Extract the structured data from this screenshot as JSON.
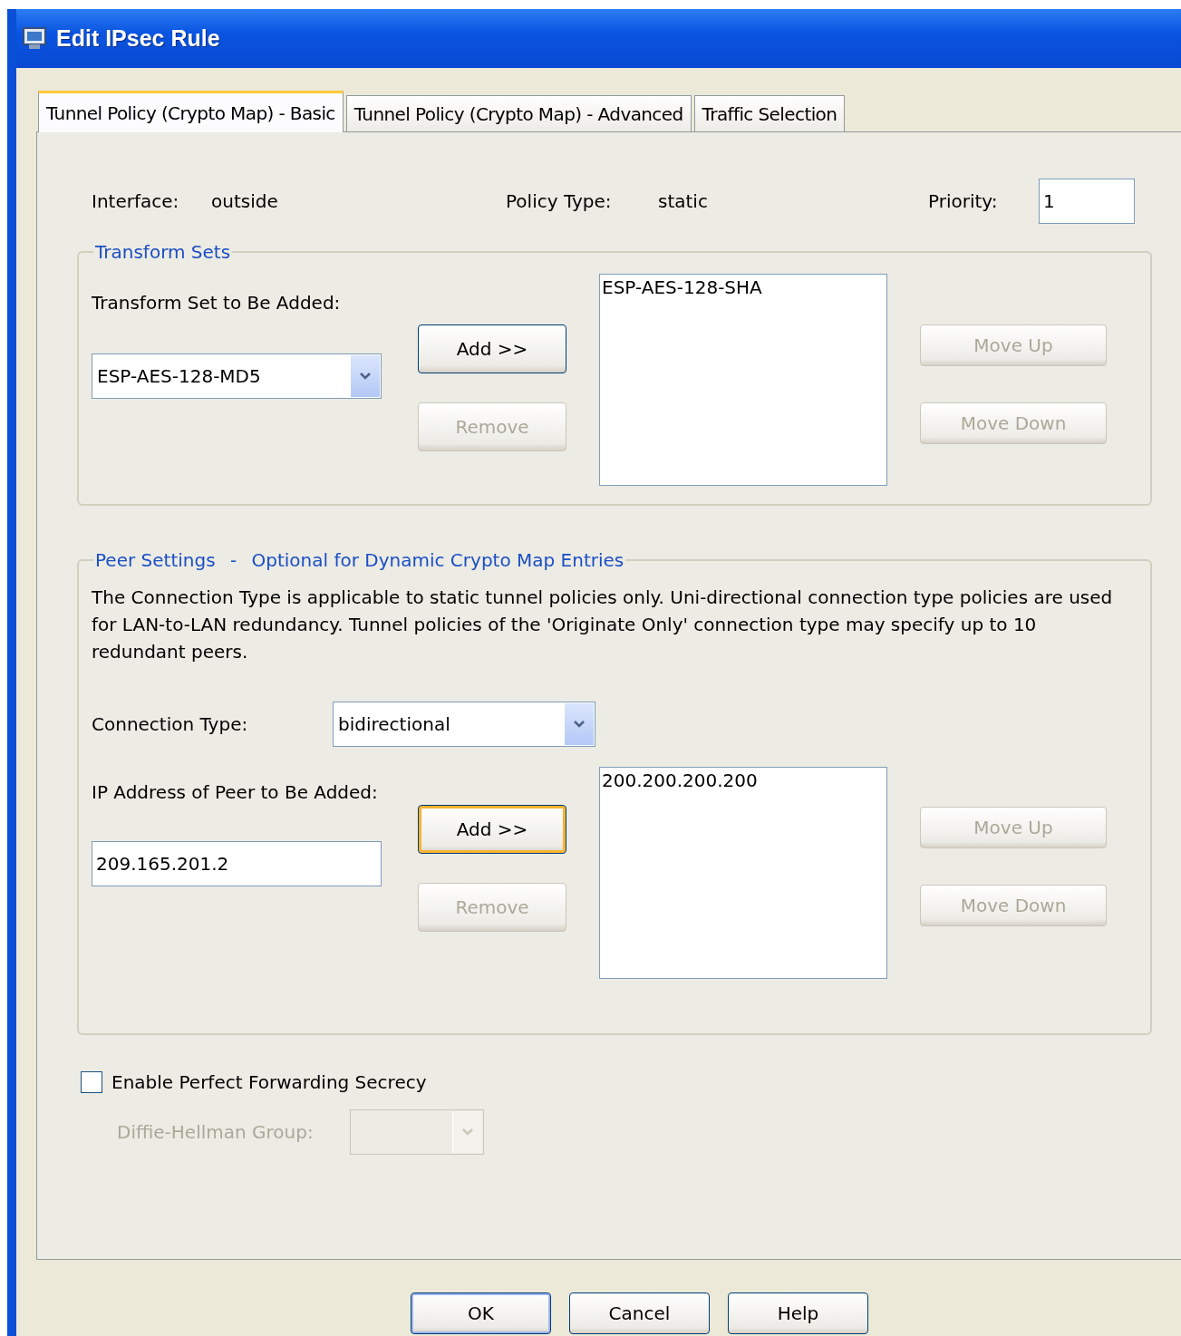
{
  "window": {
    "title": "Edit IPsec Rule"
  },
  "tabs": [
    {
      "label": "Tunnel Policy (Crypto Map) - Basic",
      "selected": true
    },
    {
      "label": "Tunnel Policy (Crypto Map) - Advanced",
      "selected": false
    },
    {
      "label": "Traffic Selection",
      "selected": false
    }
  ],
  "interface": {
    "label": "Interface:",
    "value": "outside"
  },
  "policy_type": {
    "label": "Policy Type:",
    "value": "static"
  },
  "priority": {
    "label": "Priority:",
    "value": "1"
  },
  "transform_sets": {
    "title": "Transform Sets",
    "add_label": "Transform Set to Be Added:",
    "select_value": "ESP-AES-128-MD5",
    "add_button": {
      "label": "Add >>",
      "disabled": false,
      "focused": false
    },
    "remove_button": {
      "label": "Remove",
      "disabled": true
    },
    "list": [
      "ESP-AES-128-SHA"
    ],
    "move_up": {
      "label": "Move Up",
      "disabled": true
    },
    "move_down": {
      "label": "Move Down",
      "disabled": true
    }
  },
  "peer_settings": {
    "title": "Peer Settings",
    "separator": "-",
    "subtitle": "Optional for Dynamic Crypto Map Entries",
    "description": "The Connection Type is applicable to static tunnel policies only. Uni-directional connection type policies are used for LAN-to-LAN redundancy. Tunnel policies of the 'Originate Only' connection type may specify up to 10 redundant peers.",
    "connection_type": {
      "label": "Connection Type:",
      "value": "bidirectional"
    },
    "peer_label": "IP Address of Peer to Be Added:",
    "peer_value": "209.165.201.2",
    "add_button": {
      "label": "Add >>",
      "disabled": false,
      "focused": true
    },
    "remove_button": {
      "label": "Remove",
      "disabled": true
    },
    "list": [
      "200.200.200.200"
    ],
    "move_up": {
      "label": "Move Up",
      "disabled": true
    },
    "move_down": {
      "label": "Move Down",
      "disabled": true
    }
  },
  "pfs": {
    "label": "Enable Perfect Forwarding Secrecy",
    "checked": false
  },
  "dh_group": {
    "label": "Diffie-Hellman Group:",
    "disabled": true
  },
  "buttons": [
    {
      "label": "OK",
      "default": true
    },
    {
      "label": "Cancel",
      "default": false
    },
    {
      "label": "Help",
      "default": false
    }
  ]
}
